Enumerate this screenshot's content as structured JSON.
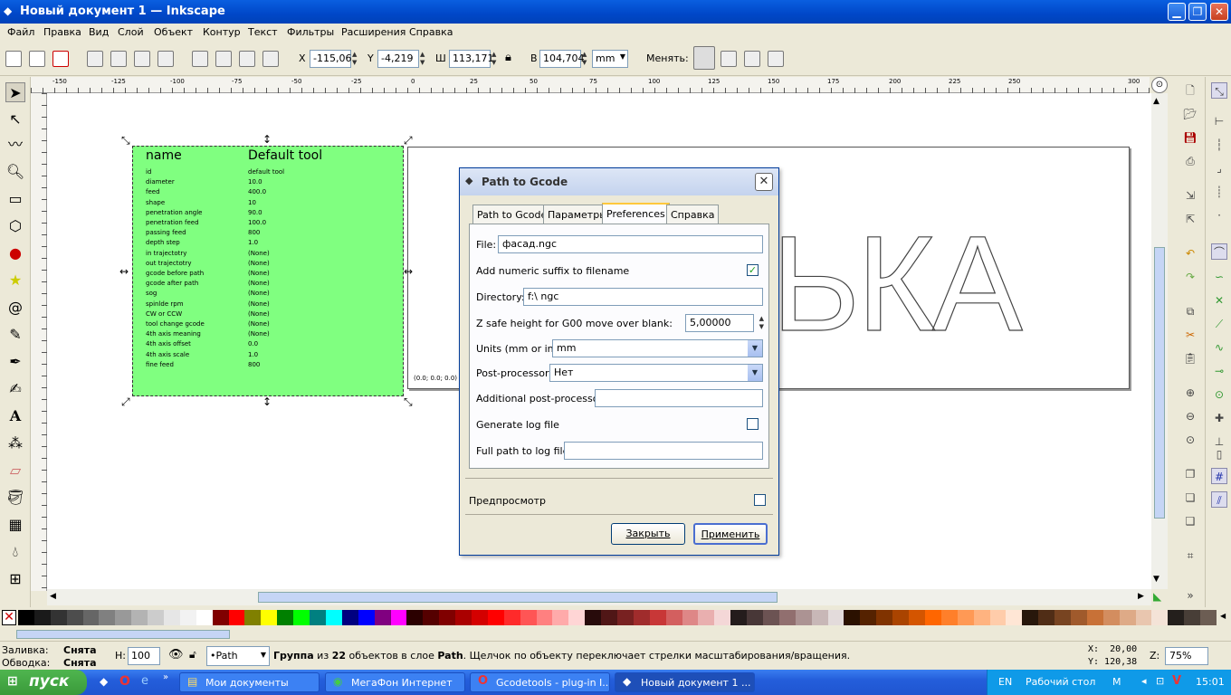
{
  "window": {
    "title": "Новый документ 1 — Inkscape"
  },
  "menu": [
    "Файл",
    "Правка",
    "Вид",
    "Слой",
    "Объект",
    "Контур",
    "Текст",
    "Фильтры",
    "Расширения",
    "Справка"
  ],
  "toolbar": {
    "x_label": "X",
    "x_value": "-115,06",
    "y_label": "Y",
    "y_value": "-4,219",
    "w_label": "Ш",
    "w_value": "113,171",
    "h_label": "В",
    "h_value": "104,704",
    "unit": "mm",
    "change_label": "Менять:"
  },
  "ruler_h_ticks": [
    "-150",
    "-125",
    "-100",
    "-75",
    "-50",
    "-25",
    "0",
    "25",
    "50",
    "75",
    "100",
    "125",
    "150",
    "175",
    "200",
    "225",
    "250",
    "300"
  ],
  "tool_table": {
    "header_left": "name",
    "header_right": "Default tool",
    "rows": [
      [
        "id",
        "default tool"
      ],
      [
        "diameter",
        "10.0"
      ],
      [
        "feed",
        "400.0"
      ],
      [
        "shape",
        "10"
      ],
      [
        "penetration angle",
        "90.0"
      ],
      [
        "penetration feed",
        "100.0"
      ],
      [
        "passing feed",
        "800"
      ],
      [
        "depth step",
        "1.0"
      ],
      [
        "in trajectotry",
        "(None)"
      ],
      [
        "out trajectotry",
        "(None)"
      ],
      [
        "gcode before path",
        "(None)"
      ],
      [
        "gcode after path",
        "(None)"
      ],
      [
        "sog",
        "(None)"
      ],
      [
        "spinlde rpm",
        "(None)"
      ],
      [
        "CW or CCW",
        "(None)"
      ],
      [
        "tool change gcode",
        "(None)"
      ],
      [
        "4th axis meaning",
        "(None)"
      ],
      [
        "4th axis offset",
        "0.0"
      ],
      [
        "4th axis scale",
        "1.0"
      ],
      [
        "fine feed",
        "800"
      ]
    ]
  },
  "canvas_text": {
    "big_letters": "ЬКА",
    "origin_label": "(0.0; 0.0; 0.0)"
  },
  "dialog": {
    "title": "Path to Gcode",
    "tabs": [
      "Path to Gcode",
      "Параметры",
      "Preferences",
      "Справка"
    ],
    "active_tab": "Preferences",
    "file_label": "File:",
    "file_value": "фасад.ngc",
    "suffix_label": "Add numeric suffix to filename",
    "suffix_checked": true,
    "dir_label": "Directory:",
    "dir_value": "f:\\ ngc",
    "zsafe_label": "Z safe height for G00 move over blank:",
    "zsafe_value": "5,00000",
    "units_label": "Units (mm or in):",
    "units_value": "mm",
    "post_label": "Post-processor:",
    "post_value": "Нет",
    "addpost_label": "Additional post-processor:",
    "addpost_value": "",
    "log_label": "Generate log file",
    "log_checked": false,
    "logpath_label": "Full path to log file:",
    "logpath_value": "",
    "preview_label": "Предпросмотр",
    "close_label": "Закрыть",
    "apply_label": "Применить"
  },
  "status": {
    "fill_label": "Заливка:",
    "fill_value": "Снята",
    "stroke_label": "Обводка:",
    "stroke_value": "Снята",
    "h_label": "H:",
    "h_value": "100",
    "layer": "•Path",
    "message_bold": "Группа",
    "message_rest1": " из ",
    "message_count": "22",
    "message_rest2": " объектов в слое ",
    "message_layer": "Path",
    "message_rest3": ". Щелчок по объекту переключает стрелки масштабирования/вращения.",
    "x_coord": "X:  20,00",
    "y_coord": "Y: 120,38",
    "zoom_label": "Z:",
    "zoom_value": "75%"
  },
  "taskbar": {
    "start": "пуск",
    "tasks": [
      "Мои документы",
      "МегаФон Интернет",
      "Gcodetools - plug-in I...",
      "Новый документ 1 ..."
    ],
    "lang": "EN",
    "desktop": "Рабочий стол",
    "m": "M",
    "clock": "15:01"
  },
  "palette_colors": [
    "#000000",
    "#1a1a1a",
    "#333333",
    "#4d4d4d",
    "#666666",
    "#808080",
    "#999999",
    "#b3b3b3",
    "#cccccc",
    "#e6e6e6",
    "#f2f2f2",
    "#ffffff",
    "#800000",
    "#ff0000",
    "#808000",
    "#ffff00",
    "#008000",
    "#00ff00",
    "#008080",
    "#00ffff",
    "#000080",
    "#0000ff",
    "#800080",
    "#ff00ff",
    "#2b0000",
    "#550000",
    "#800000",
    "#aa0000",
    "#d40000",
    "#ff0000",
    "#ff2a2a",
    "#ff5555",
    "#ff8080",
    "#ffaaaa",
    "#ffd5d5",
    "#280b0b",
    "#501616",
    "#782121",
    "#a02c2c",
    "#c83737",
    "#d35f5f",
    "#de8787",
    "#e9afaf",
    "#f4d7d7",
    "#241c1c",
    "#483737",
    "#6c5353",
    "#916f6f",
    "#ac9393",
    "#c8b7b7",
    "#e3dbdb",
    "#2b1100",
    "#552200",
    "#803300",
    "#aa4400",
    "#d45500",
    "#ff6600",
    "#ff7f2a",
    "#ff9955",
    "#ffb380",
    "#ffccaa",
    "#ffe6d5",
    "#28170b",
    "#502d16",
    "#784421",
    "#a05a2c",
    "#c87137",
    "#d38d5f",
    "#deaa87",
    "#e9c6af",
    "#f4e3d7",
    "#241f1c",
    "#483e37",
    "#6c5d53"
  ]
}
